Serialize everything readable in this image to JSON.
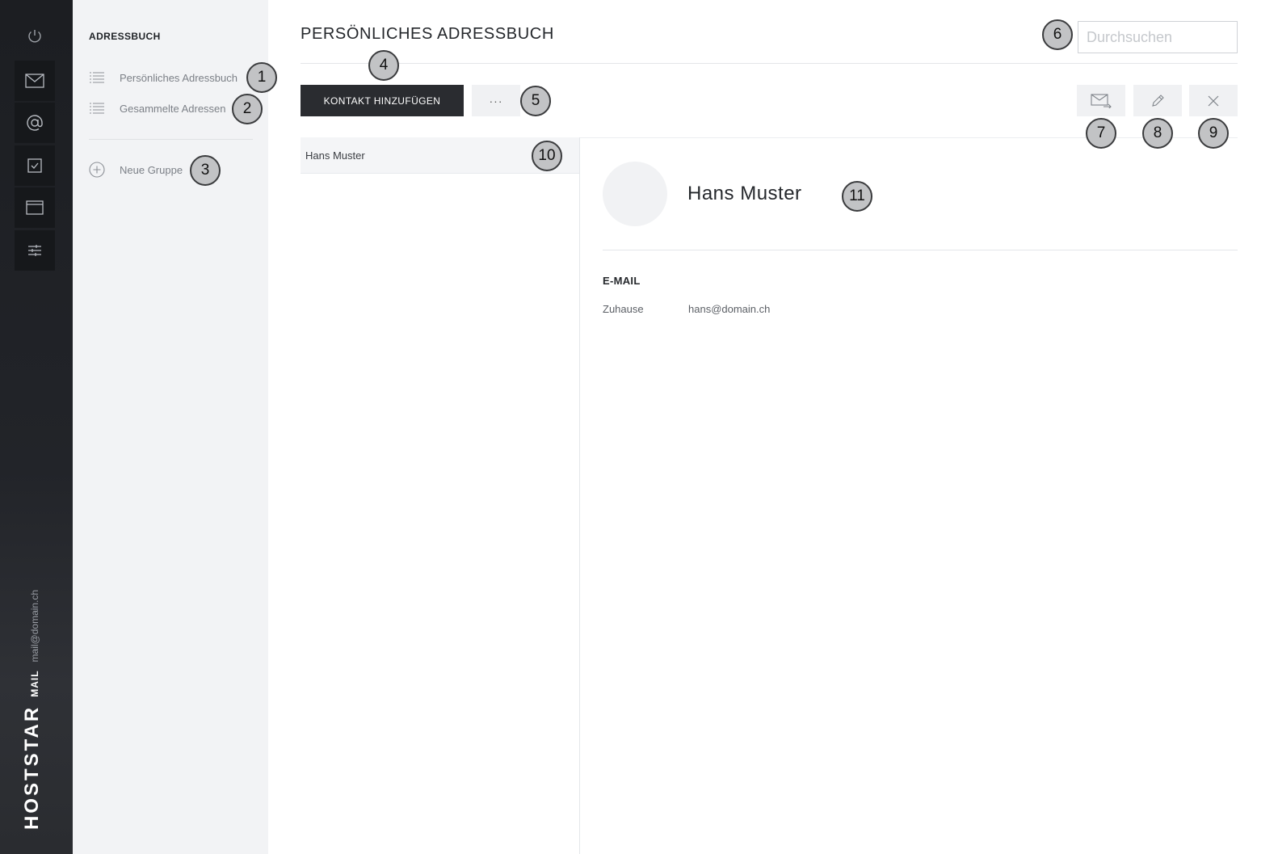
{
  "rail": {
    "icons": [
      "power-icon",
      "mail-icon",
      "at-icon",
      "tasks-icon",
      "calendar-icon",
      "settings-icon"
    ],
    "brand": "HOSTSTAR",
    "product": "MAIL",
    "account": "mail@domain.ch"
  },
  "sidebar": {
    "title": "ADRESSBUCH",
    "items": [
      {
        "label": "Persönliches Adressbuch",
        "icon": "list-icon"
      },
      {
        "label": "Gesammelte Adressen",
        "icon": "list-icon"
      }
    ],
    "new_group": {
      "label": "Neue Gruppe",
      "icon": "plus-circle-icon"
    }
  },
  "main": {
    "title": "PERSÖNLICHES ADRESSBUCH",
    "search_placeholder": "Durchsuchen",
    "add_contact_label": "KONTAKT HINZUFÜGEN",
    "more_label": "···",
    "actions": [
      "mail-icon",
      "edit-icon",
      "close-icon"
    ]
  },
  "contacts": [
    {
      "name": "Hans Muster"
    }
  ],
  "detail": {
    "name": "Hans Muster",
    "section": "E-MAIL",
    "field_label": "Zuhause",
    "field_value": "hans@domain.ch"
  },
  "badges": [
    "1",
    "2",
    "3",
    "4",
    "5",
    "6",
    "7",
    "8",
    "9",
    "10",
    "11"
  ],
  "colors": {
    "rail": "#1c1e22",
    "sidebar": "#f2f3f5",
    "primary_button": "#2a2c30",
    "badge": "#c2c3c5"
  }
}
